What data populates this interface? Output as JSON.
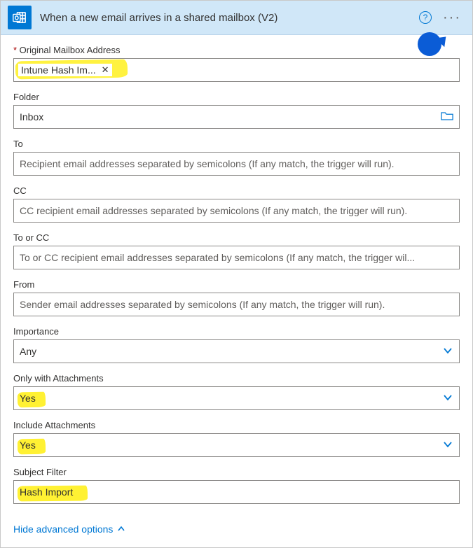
{
  "header": {
    "title": "When a new email arrives in a shared mailbox (V2)"
  },
  "fields": {
    "mailbox": {
      "label": "Original Mailbox Address",
      "tag": "Intune Hash Im..."
    },
    "folder": {
      "label": "Folder",
      "value": "Inbox"
    },
    "to": {
      "label": "To",
      "placeholder": "Recipient email addresses separated by semicolons (If any match, the trigger will run)."
    },
    "cc": {
      "label": "CC",
      "placeholder": "CC recipient email addresses separated by semicolons (If any match, the trigger will run)."
    },
    "tocc": {
      "label": "To or CC",
      "placeholder": "To or CC recipient email addresses separated by semicolons (If any match, the trigger wil..."
    },
    "from": {
      "label": "From",
      "placeholder": "Sender email addresses separated by semicolons (If any match, the trigger will run)."
    },
    "importance": {
      "label": "Importance",
      "value": "Any"
    },
    "onlyAttach": {
      "label": "Only with Attachments",
      "value": "Yes"
    },
    "inclAttach": {
      "label": "Include Attachments",
      "value": "Yes"
    },
    "subject": {
      "label": "Subject Filter",
      "value": "Hash Import"
    }
  },
  "footer": {
    "hide": "Hide advanced options"
  }
}
